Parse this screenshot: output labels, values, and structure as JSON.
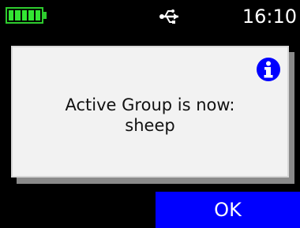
{
  "status_bar": {
    "battery_cells": 5,
    "battery_color": "#33e533",
    "usb_icon": "usb-icon",
    "time": "16:10"
  },
  "dialog": {
    "icon": "info-icon",
    "icon_color": "#0000ff",
    "message_line1": "Active Group is now:",
    "message_line2": "sheep"
  },
  "actions": {
    "ok_label": "OK",
    "ok_color": "#0000ff"
  }
}
